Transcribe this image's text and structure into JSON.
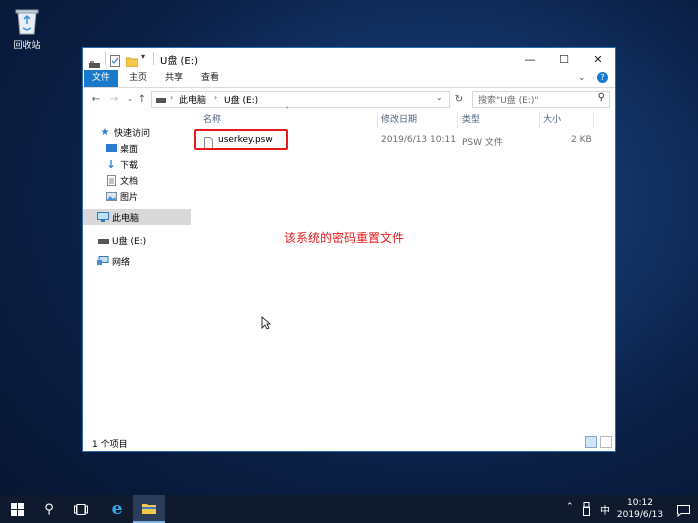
{
  "desktop": {
    "recycle_bin_label": "回收站"
  },
  "window": {
    "title": "U盘 (E:)",
    "minimize_glyph": "—",
    "maximize_glyph": "☐",
    "close_glyph": "✕",
    "ribbon_tabs": [
      "文件",
      "主页",
      "共享",
      "查看"
    ],
    "help_glyph": "?"
  },
  "address": {
    "breadcrumb": [
      "此电脑",
      "U盘 (E:)"
    ],
    "search_placeholder": "搜索\"U盘 (E:)\""
  },
  "nav": {
    "quick_access": "快速访问",
    "items": [
      "桌面",
      "下载",
      "文档",
      "图片"
    ],
    "this_pc": "此电脑",
    "drive": "U盘 (E:)",
    "network": "网络"
  },
  "columns": [
    "名称",
    "修改日期",
    "类型",
    "大小"
  ],
  "files": [
    {
      "name": "userkey.psw",
      "date": "2019/6/13 10:11",
      "type": "PSW 文件",
      "size": "2 KB"
    }
  ],
  "annotation": {
    "text": "该系统的密码重置文件",
    "color": "#e81b1b"
  },
  "status": {
    "count_text": "1 个项目"
  },
  "taskbar": {
    "time": "10:12",
    "date": "2019/6/13",
    "ime": "中"
  },
  "colors": {
    "accent": "#1979ca",
    "highlight": "#e81b1b"
  }
}
